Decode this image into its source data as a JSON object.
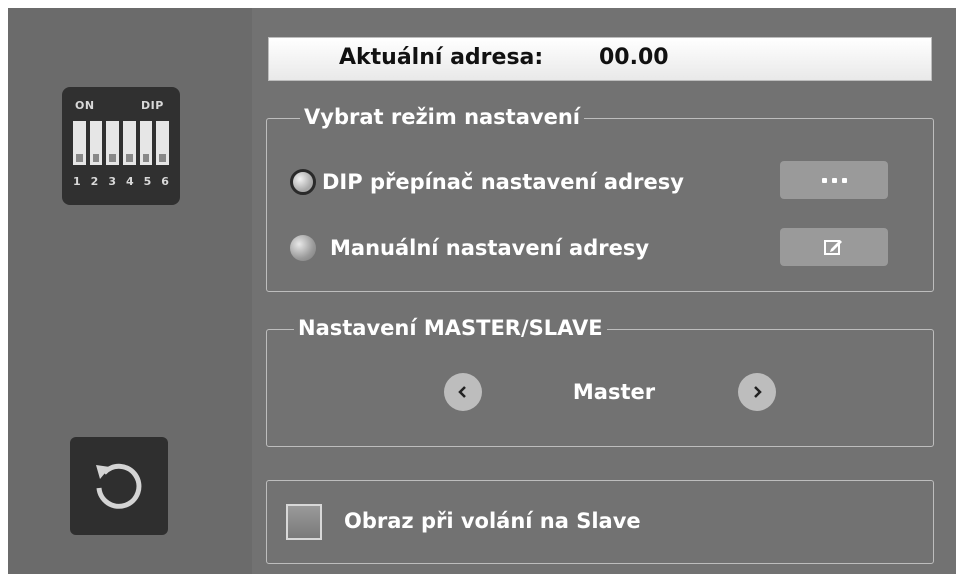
{
  "dip_icon": {
    "on_label": "ON",
    "dip_label": "DIP",
    "switch_numbers": [
      "1",
      "2",
      "3",
      "4",
      "5",
      "6"
    ]
  },
  "reset_button": {
    "icon": "reset-icon"
  },
  "address": {
    "label": "Aktuální adresa:",
    "value": "00.00"
  },
  "mode_group": {
    "title": "Vybrat režim nastavení",
    "options": [
      {
        "label": "DIP přepínač nastavení adresy",
        "selected": true,
        "button_icon": "more-icon"
      },
      {
        "label": "Manuální nastavení adresy",
        "selected": false,
        "button_icon": "edit-icon"
      }
    ]
  },
  "master_slave": {
    "title": "Nastavení MASTER/SLAVE",
    "value": "Master",
    "prev_icon": "chevron-left-icon",
    "next_icon": "chevron-right-icon"
  },
  "slave_image": {
    "label": "Obraz při volání na Slave",
    "checked": false
  }
}
